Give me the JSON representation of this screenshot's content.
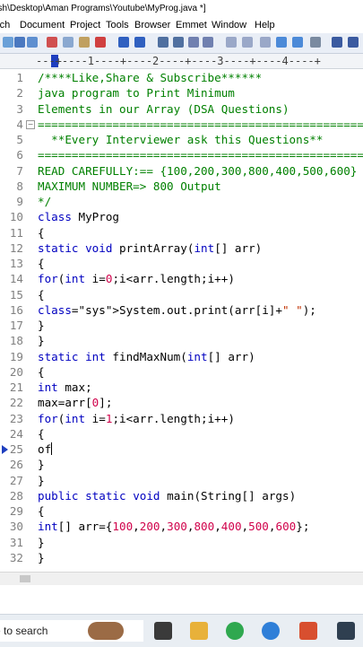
{
  "window": {
    "title": "ash\\Desktop\\Aman Programs\\Youtube\\MyProg.java *]"
  },
  "menu": {
    "items": [
      "rch",
      "Document",
      "Project",
      "Tools",
      "Browser",
      "Emmet",
      "Window",
      "Help"
    ]
  },
  "ruler": {
    "text": "---+----1----+----2----+----3----+----4----+"
  },
  "editor": {
    "lines": [
      {
        "n": "1",
        "t": "/****Like,Share & Subscribe******"
      },
      {
        "n": "2",
        "t": "java program to Print Minimum"
      },
      {
        "n": "3",
        "t": "Elements in our Array (DSA Questions)"
      },
      {
        "n": "4",
        "t": "================================================"
      },
      {
        "n": "5",
        "t": "  **Every Interviewer ask this Questions**"
      },
      {
        "n": "6",
        "t": "================================================"
      },
      {
        "n": "7",
        "t": "READ CAREFULLY:== {100,200,300,800,400,500,600}"
      },
      {
        "n": "8",
        "t": "MAXIMUM NUMBER=> 800 Output"
      },
      {
        "n": "9",
        "t": "*/"
      },
      {
        "n": "10",
        "t": "class MyProg"
      },
      {
        "n": "11",
        "t": "{"
      },
      {
        "n": "12",
        "t": "static void printArray(int[] arr)"
      },
      {
        "n": "13",
        "t": "{"
      },
      {
        "n": "14",
        "t": "for(int i=0;i<arr.length;i++)"
      },
      {
        "n": "15",
        "t": "{"
      },
      {
        "n": "16",
        "t": "System.out.print(arr[i]+\" \");"
      },
      {
        "n": "17",
        "t": "}"
      },
      {
        "n": "18",
        "t": "}"
      },
      {
        "n": "19",
        "t": "static int findMaxNum(int[] arr)"
      },
      {
        "n": "20",
        "t": "{"
      },
      {
        "n": "21",
        "t": "int max;"
      },
      {
        "n": "22",
        "t": "max=arr[0];"
      },
      {
        "n": "23",
        "t": "for(int i=1;i<arr.length;i++)"
      },
      {
        "n": "24",
        "t": "{"
      },
      {
        "n": "25",
        "t": "of"
      },
      {
        "n": "26",
        "t": "}"
      },
      {
        "n": "27",
        "t": "}"
      },
      {
        "n": "28",
        "t": "public static void main(String[] args)"
      },
      {
        "n": "29",
        "t": "{"
      },
      {
        "n": "30",
        "t": "int[] arr={100,200,300,800,400,500,600};"
      },
      {
        "n": "31",
        "t": "}"
      },
      {
        "n": "32",
        "t": "}"
      }
    ]
  },
  "taskbar": {
    "search_text": "re to search"
  },
  "colors": {
    "keyword": "#0000c0",
    "comment": "#008000",
    "number": "#d0004a",
    "string": "#c03000"
  }
}
